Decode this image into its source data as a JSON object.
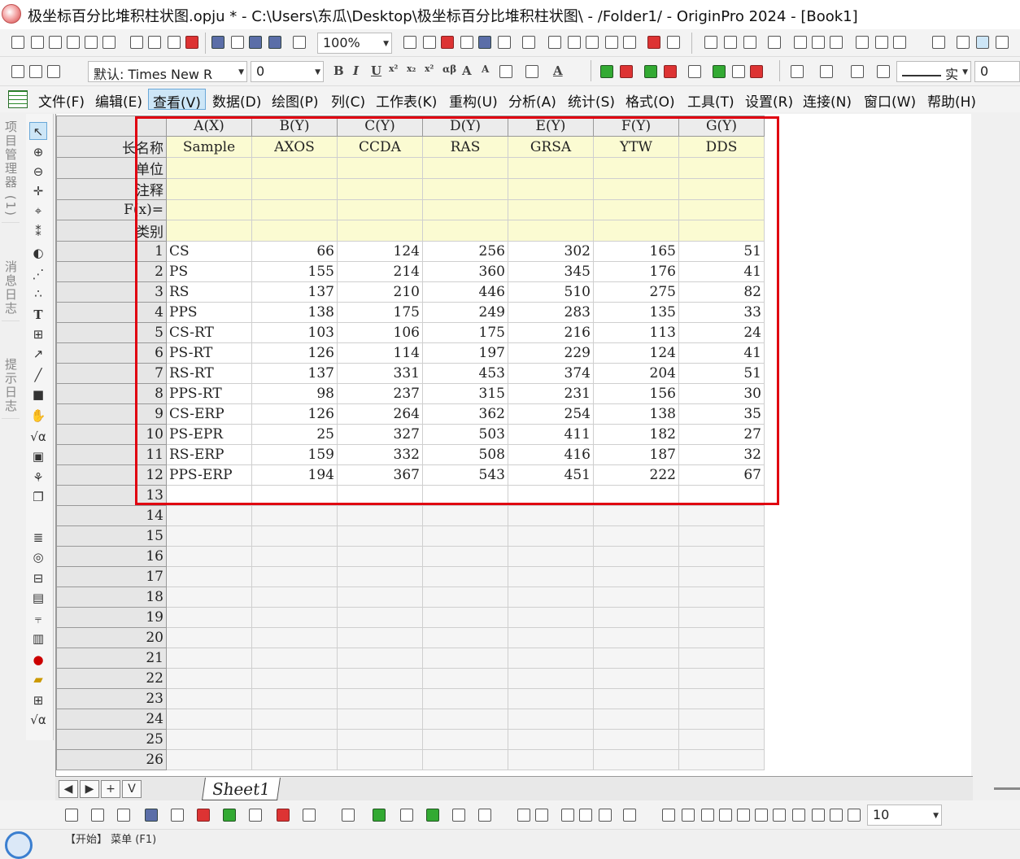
{
  "window_title": "极坐标百分比堆积柱状图.opju * - C:\\Users\\东瓜\\Desktop\\极坐标百分比堆积柱状图\\ - /Folder1/ - OriginPro 2024 - [Book1]",
  "toolbar": {
    "zoom": "100%",
    "font": "默认: Times New R",
    "font_size": "0",
    "line_style": "实",
    "line_width": "0",
    "bottom_size": "10"
  },
  "menu": [
    "文件(F)",
    "编辑(E)",
    "查看(V)",
    "数据(D)",
    "绘图(P)",
    "列(C)",
    "工作表(K)",
    "重构(U)",
    "分析(A)",
    "统计(S)",
    "格式(O)",
    "工具(T)",
    "设置(R)",
    "连接(N)",
    "窗口(W)",
    "帮助(H)"
  ],
  "active_menu": "查看(V)",
  "side_tabs": [
    "项目管理器 (1)",
    "消息日志",
    "提示日志"
  ],
  "worksheet": {
    "columns": [
      "A(X)",
      "B(Y)",
      "C(Y)",
      "D(Y)",
      "E(Y)",
      "F(Y)",
      "G(Y)"
    ],
    "meta_rows": [
      {
        "label": "长名称",
        "values": [
          "Sample",
          "AXOS",
          "CCDA",
          "RAS",
          "GRSA",
          "YTW",
          "DDS"
        ]
      },
      {
        "label": "单位",
        "values": [
          "",
          "",
          "",
          "",
          "",
          "",
          ""
        ]
      },
      {
        "label": "注释",
        "values": [
          "",
          "",
          "",
          "",
          "",
          "",
          ""
        ]
      },
      {
        "label": "F(x)=",
        "values": [
          "",
          "",
          "",
          "",
          "",
          "",
          ""
        ]
      },
      {
        "label": "类别",
        "values": [
          "",
          "",
          "",
          "",
          "",
          "",
          ""
        ]
      }
    ],
    "rows": [
      [
        "1",
        "CS",
        "66",
        "124",
        "256",
        "302",
        "165",
        "51"
      ],
      [
        "2",
        "PS",
        "155",
        "214",
        "360",
        "345",
        "176",
        "41"
      ],
      [
        "3",
        "RS",
        "137",
        "210",
        "446",
        "510",
        "275",
        "82"
      ],
      [
        "4",
        "PPS",
        "138",
        "175",
        "249",
        "283",
        "135",
        "33"
      ],
      [
        "5",
        "CS-RT",
        "103",
        "106",
        "175",
        "216",
        "113",
        "24"
      ],
      [
        "6",
        "PS-RT",
        "126",
        "114",
        "197",
        "229",
        "124",
        "41"
      ],
      [
        "7",
        "RS-RT",
        "137",
        "331",
        "453",
        "374",
        "204",
        "51"
      ],
      [
        "8",
        "PPS-RT",
        "98",
        "237",
        "315",
        "231",
        "156",
        "30"
      ],
      [
        "9",
        "CS-ERP",
        "126",
        "264",
        "362",
        "254",
        "138",
        "35"
      ],
      [
        "10",
        "PS-EPR",
        "25",
        "327",
        "503",
        "411",
        "182",
        "27"
      ],
      [
        "11",
        "RS-ERP",
        "159",
        "332",
        "508",
        "416",
        "187",
        "32"
      ],
      [
        "12",
        "PPS-ERP",
        "194",
        "367",
        "543",
        "451",
        "222",
        "67"
      ]
    ],
    "empty_rows": [
      "13",
      "14",
      "15",
      "16",
      "17",
      "18",
      "19",
      "20",
      "21",
      "22",
      "23",
      "24",
      "25",
      "26"
    ]
  },
  "sheet_tab": "Sheet1",
  "sheet_nav": [
    "◀",
    "▶",
    "+",
    "V"
  ],
  "status": "【开始】 菜单 (F1)",
  "highlight_color": "#e00010"
}
